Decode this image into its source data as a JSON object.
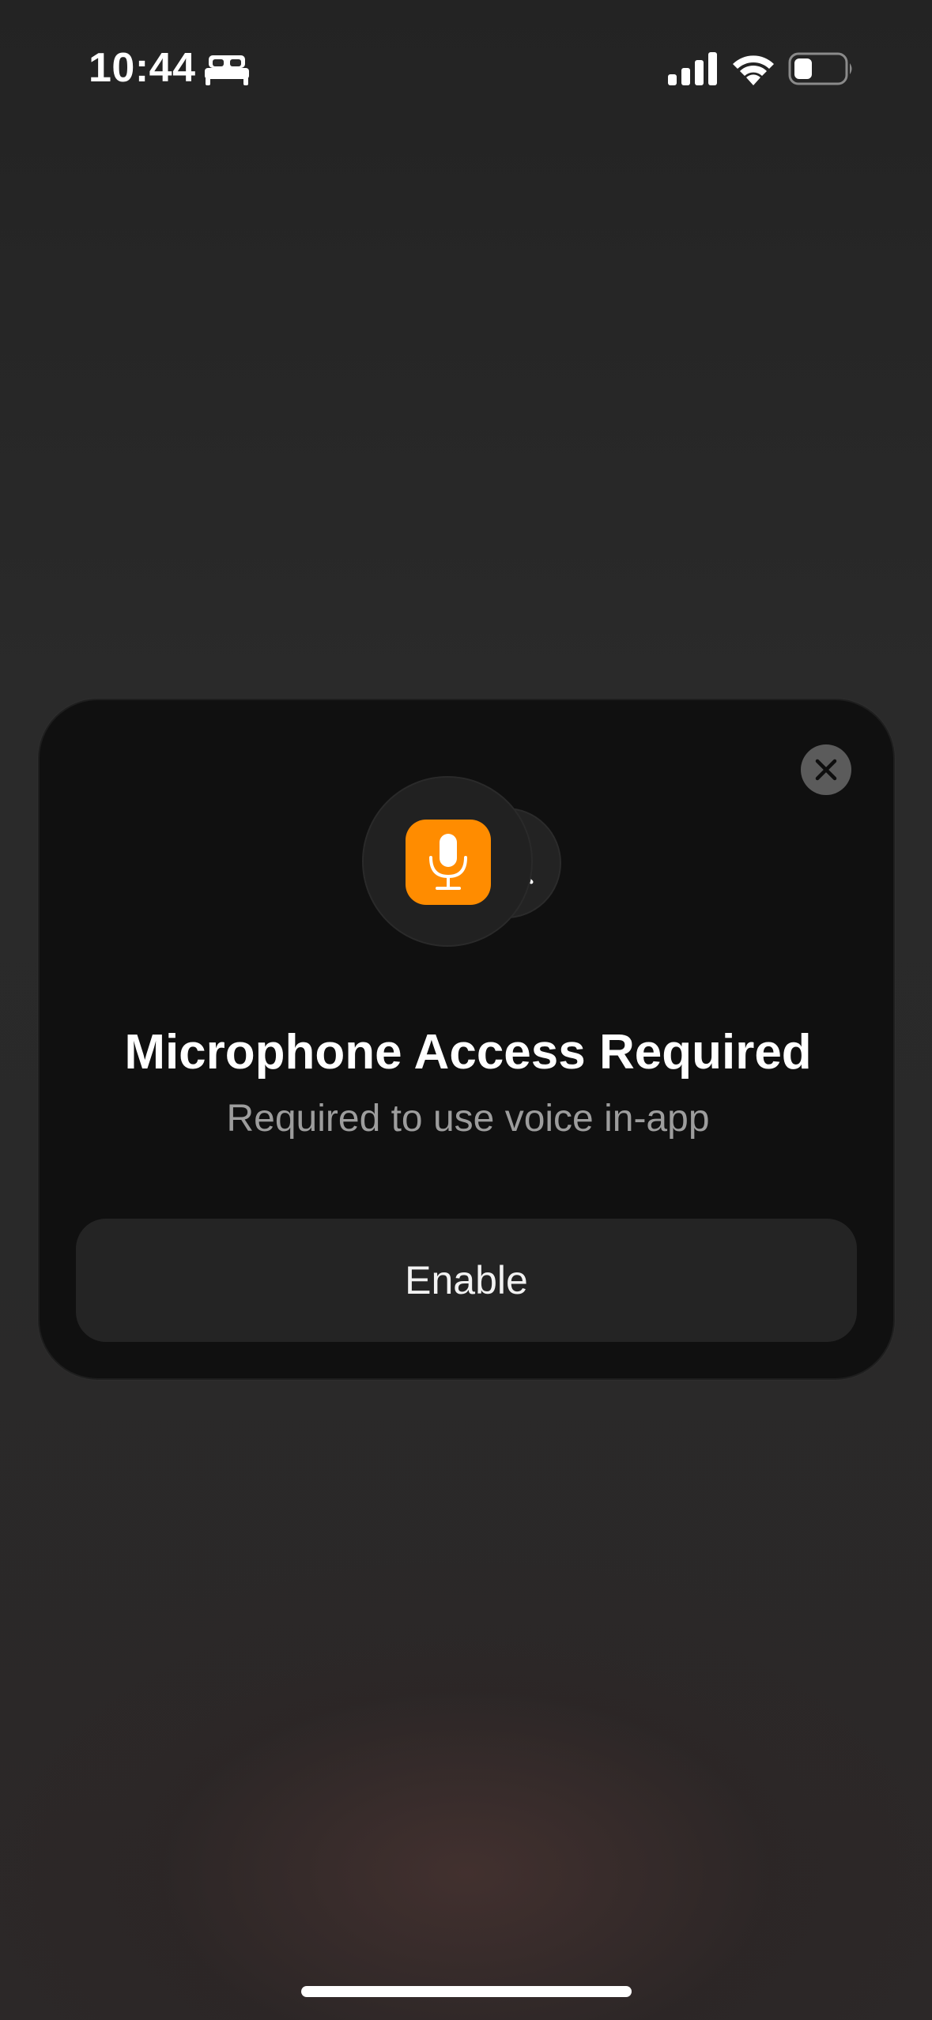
{
  "status_bar": {
    "time": "10:44",
    "focus_icon": "bed-icon",
    "signal_icon": "cellular-signal-icon",
    "wifi_icon": "wifi-icon",
    "battery_icon": "battery-low-icon"
  },
  "dialog": {
    "title": "Microphone Access Required",
    "subtitle": "Required to use voice in-app",
    "primary_icon": "microphone-icon",
    "secondary_icon": "microphone-disabled-icon",
    "close_icon": "close-icon",
    "enable_label": "Enable"
  },
  "colors": {
    "accent": "#FF8C00",
    "card_background": "#101010",
    "button_background": "#242424",
    "subtitle_text": "#9D9D9D"
  }
}
